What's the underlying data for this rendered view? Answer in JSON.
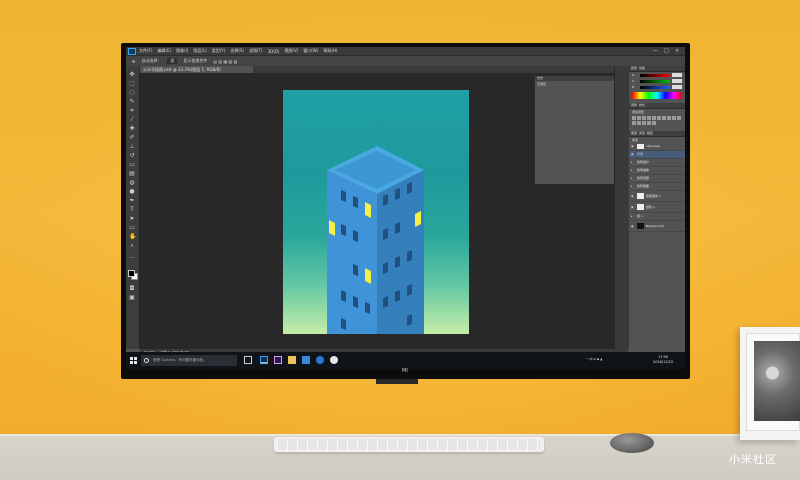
{
  "photoshop": {
    "menus": [
      "文件(F)",
      "编辑(E)",
      "图像(I)",
      "图层(L)",
      "类型(Y)",
      "选择(S)",
      "滤镜(T)",
      "3D(D)",
      "视图(V)",
      "窗口(W)",
      "帮助(H)"
    ],
    "window_controls": [
      "—",
      "□",
      "×"
    ],
    "options": {
      "auto_select_label": "自动选择：",
      "auto_select_value": "组",
      "transform_controls": "显示变换控件"
    },
    "document_tab": "公众号插图.psd @ 33.3%(图层 1, RGB/8)",
    "status": {
      "zoom": "33.33%",
      "doc_size": "文档:21.7M/105.4M"
    },
    "history_panel": {
      "tab": "历史",
      "item": "无题色"
    },
    "color_panel": {
      "tabs": [
        "颜色",
        "色板"
      ],
      "sliders": [
        {
          "label": "R",
          "gradient": "#ff0000"
        },
        {
          "label": "G",
          "gradient": "#00c000"
        },
        {
          "label": "B",
          "gradient": "#2060ff"
        }
      ]
    },
    "adjustments_panel": {
      "tabs": [
        "调整",
        "样式"
      ],
      "add_label": "添加调整"
    },
    "layers_panel": {
      "tabs": [
        "图层",
        "通道",
        "路径"
      ],
      "kind": "类型",
      "layers": [
        {
          "name": "cityscape",
          "selected": false
        },
        {
          "name": "灯光",
          "selected": true
        },
        {
          "name": "建筑窗户",
          "selected": false
        },
        {
          "name": "建筑墙体",
          "selected": false
        },
        {
          "name": "建筑顶部",
          "selected": false
        },
        {
          "name": "建筑侧面",
          "selected": false
        },
        {
          "name": "渐变填充 1",
          "selected": false
        },
        {
          "name": "颜色 1",
          "selected": false
        },
        {
          "name": "组 1",
          "selected": false
        },
        {
          "name": "Background",
          "selected": false
        }
      ]
    }
  },
  "taskbar": {
    "search_placeholder": "我是 Cortana。有问题尽管问我。",
    "apps": [
      "task-view",
      "photoshop",
      "premiere",
      "file-explorer",
      "store",
      "edge",
      "wechat"
    ],
    "tray": "^ 中 ⊕ ◆ ▲",
    "time": "17:00",
    "date": "2016/12/22"
  },
  "monitor_logo": "MI",
  "watermark": "小米社区",
  "colors": {
    "wall": "#f5b83a",
    "ps_dark": "#282828",
    "art_top": "#1f9fa5",
    "art_bottom": "#c6eea6",
    "building": "#3f93d6",
    "window_light": "#f4f04a"
  }
}
